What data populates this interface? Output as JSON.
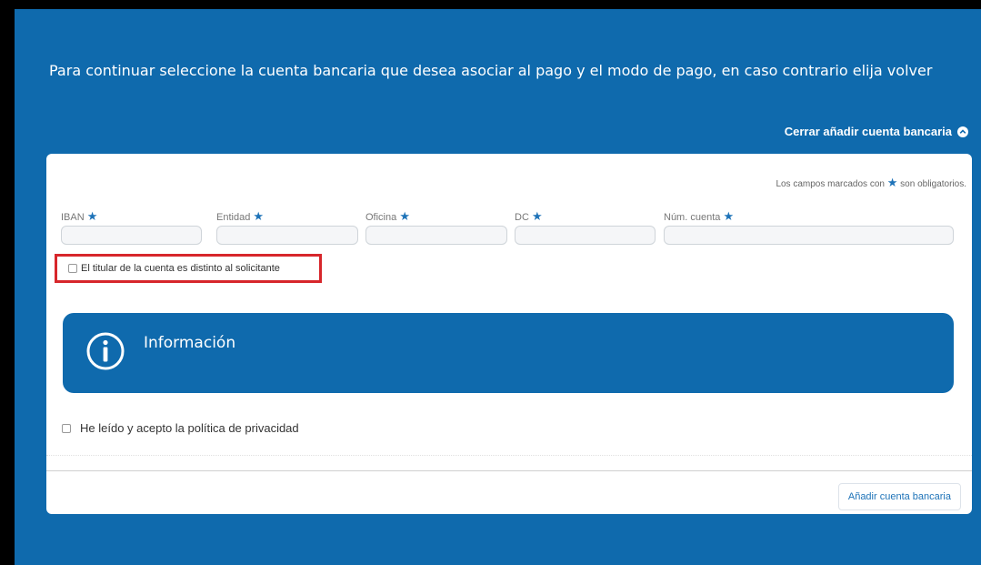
{
  "intro_text": "Para continuar seleccione la cuenta bancaria que desea asociar al pago y el modo de pago, en caso contrario elija volver",
  "toggle_link": "Cerrar añadir cuenta bancaria",
  "required_note": {
    "before": "Los campos marcados con",
    "after": "son obligatorios."
  },
  "required_symbol": "★",
  "fields": [
    {
      "label": "IBAN"
    },
    {
      "label": "Entidad"
    },
    {
      "label": "Oficina"
    },
    {
      "label": "DC"
    },
    {
      "label": "Núm. cuenta"
    }
  ],
  "holder_checkbox_label": "El titular de la cuenta es distinto al solicitante",
  "info": {
    "title": "Información"
  },
  "privacy_checkbox_label": "He leído y acepto la política de privacidad",
  "add_button_label": "Añadir cuenta bancaria",
  "colors": {
    "primary_blue": "#0f6aad",
    "highlight_red": "#d7262b",
    "link_blue": "#1e73b8"
  }
}
